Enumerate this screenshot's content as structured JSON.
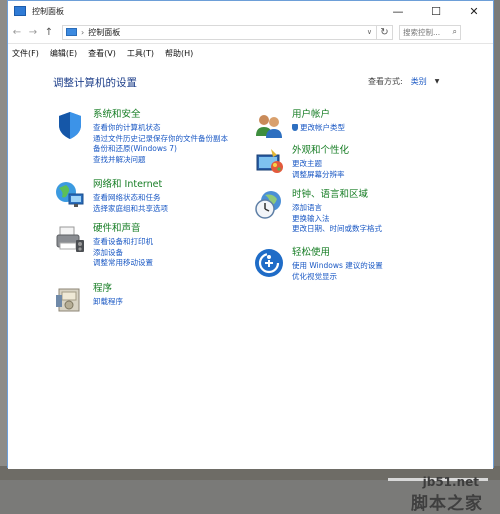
{
  "window": {
    "title": "控制面板",
    "controls": [
      "—",
      "☐",
      "✕"
    ]
  },
  "address": {
    "back": "←",
    "forward": "→",
    "up": "↑",
    "path": "控制面板",
    "refresh": "↻",
    "search_placeholder": "搜索控制..."
  },
  "menu": [
    "文件(F)",
    "编辑(E)",
    "查看(V)",
    "工具(T)",
    "帮助(H)"
  ],
  "main": {
    "title": "调整计算机的设置",
    "viewby_label": "查看方式:",
    "viewby_value": "类别",
    "categories": [
      {
        "title": "系统和安全",
        "links": [
          "查看你的计算机状态",
          "通过文件历史记录保存你的文件备份副本",
          "备份和还原(Windows 7)",
          "查找并解决问题"
        ]
      },
      {
        "title": "网络和 Internet",
        "links": [
          "查看网络状态和任务",
          "选择家庭组和共享选项"
        ]
      },
      {
        "title": "硬件和声音",
        "links": [
          "查看设备和打印机",
          "添加设备",
          "调整常用移动设置"
        ]
      },
      {
        "title": "程序",
        "links": [
          "卸载程序"
        ]
      },
      {
        "title": "用户帐户",
        "links": [
          "更改帐户类型"
        ]
      },
      {
        "title": "外观和个性化",
        "links": [
          "更改主题",
          "调整屏幕分辨率"
        ]
      },
      {
        "title": "时钟、语言和区域",
        "links": [
          "添加语言",
          "更换输入法",
          "更改日期、时间或数字格式"
        ]
      },
      {
        "title": "轻松使用",
        "links": [
          "使用 Windows 建议的设置",
          "优化视觉显示"
        ]
      }
    ]
  },
  "watermark": {
    "line1": "jb51.net",
    "line2": "脚本之家"
  },
  "colors": {
    "category_title": "#167d24",
    "link": "#1a58c4",
    "page_title": "#1e3f8a"
  }
}
